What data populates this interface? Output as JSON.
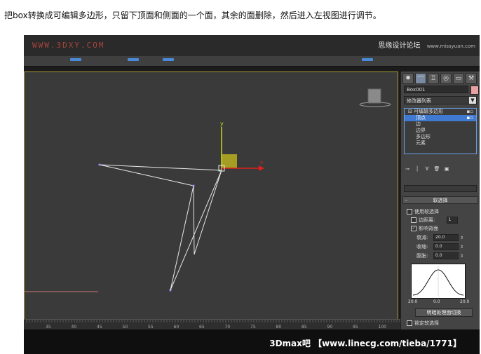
{
  "caption": "把box转换成可编辑多边形，只留下顶面和侧面的一个面，其余的面删除，然后进入左视图进行调节。",
  "watermark_left": "WWW.3DXY.COM",
  "watermark_right": "思缘设计论坛",
  "watermark_right_small": "www.missyuan.com",
  "bottom_watermark": "3Dmax吧 【www.linecg.com/tieba/1771】",
  "panel": {
    "tabs": [
      "create",
      "modify",
      "hierarchy",
      "motion",
      "display",
      "utilities"
    ],
    "object_name": "Box001",
    "modifier_list_label": "修改器列表",
    "stack": {
      "top": "可编辑多边形",
      "items": [
        "顶点",
        "边",
        "边界",
        "多边形",
        "元素"
      ],
      "selected": "顶点"
    },
    "soft_selection": {
      "title": "软选择",
      "use_soft_selection": "使用软选择",
      "edge_distance": "边距离:",
      "edge_distance_value": "1",
      "affect_backfacing": "影响背面",
      "falloff_label": "衰减:",
      "falloff_value": "20.0",
      "pinch_label": "收缩:",
      "pinch_value": "0.0",
      "bubble_label": "膨胀:",
      "bubble_value": "0.0",
      "curve_left": "20.0",
      "curve_mid": "0.0",
      "curve_right": "20.0",
      "shaded_face_toggle": "明暗处理面切换",
      "lock_soft_selection": "锁定软选择"
    }
  },
  "ruler_ticks": [
    "35",
    "40",
    "45",
    "50",
    "55",
    "60",
    "65",
    "70",
    "75",
    "80",
    "85",
    "90",
    "95",
    "100"
  ],
  "colors": {
    "viewport_bg": "#3a3a3a",
    "viewport_border": "#a89a3a",
    "gizmo_y": "#c8d820",
    "gizmo_x": "#e02020",
    "selection_blue": "#3f7ad0"
  }
}
